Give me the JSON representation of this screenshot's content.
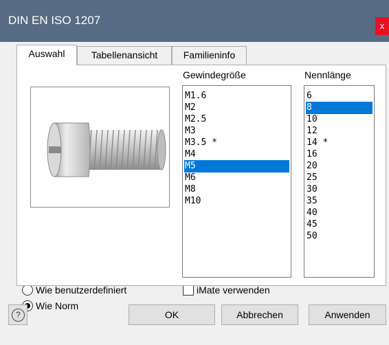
{
  "window": {
    "title": "DIN EN ISO 1207",
    "close_glyph": "x"
  },
  "tabs": [
    {
      "label": "Auswahl",
      "active": true
    },
    {
      "label": "Tabellenansicht",
      "active": false
    },
    {
      "label": "Familieninfo",
      "active": false
    }
  ],
  "preview": {
    "icon": "slotted-cheese-head-screw-icon"
  },
  "thread_size": {
    "label": "Gewindegröße",
    "items": [
      "M1.6",
      "M2",
      "M2.5",
      "M3",
      "M3.5 *",
      "M4",
      "M5",
      "M6",
      "M8",
      "M10"
    ],
    "selected": "M5"
  },
  "nominal_length": {
    "label": "Nennlänge",
    "items": [
      "6",
      "8",
      "10",
      "12",
      "14 *",
      "16",
      "20",
      "25",
      "30",
      "35",
      "40",
      "45",
      "50"
    ],
    "selected": "8"
  },
  "options": {
    "radio_user_defined": "Wie benutzerdefiniert",
    "radio_standard": "Wie Norm",
    "selected_radio": "Wie Norm",
    "imate_label": "iMate verwenden",
    "imate_checked": false
  },
  "buttons": {
    "help": "?",
    "ok": "OK",
    "cancel": "Abbrechen",
    "apply": "Anwenden"
  },
  "colors": {
    "titlebar": "#586b84",
    "selection": "#0078d7",
    "close": "#e81123"
  }
}
